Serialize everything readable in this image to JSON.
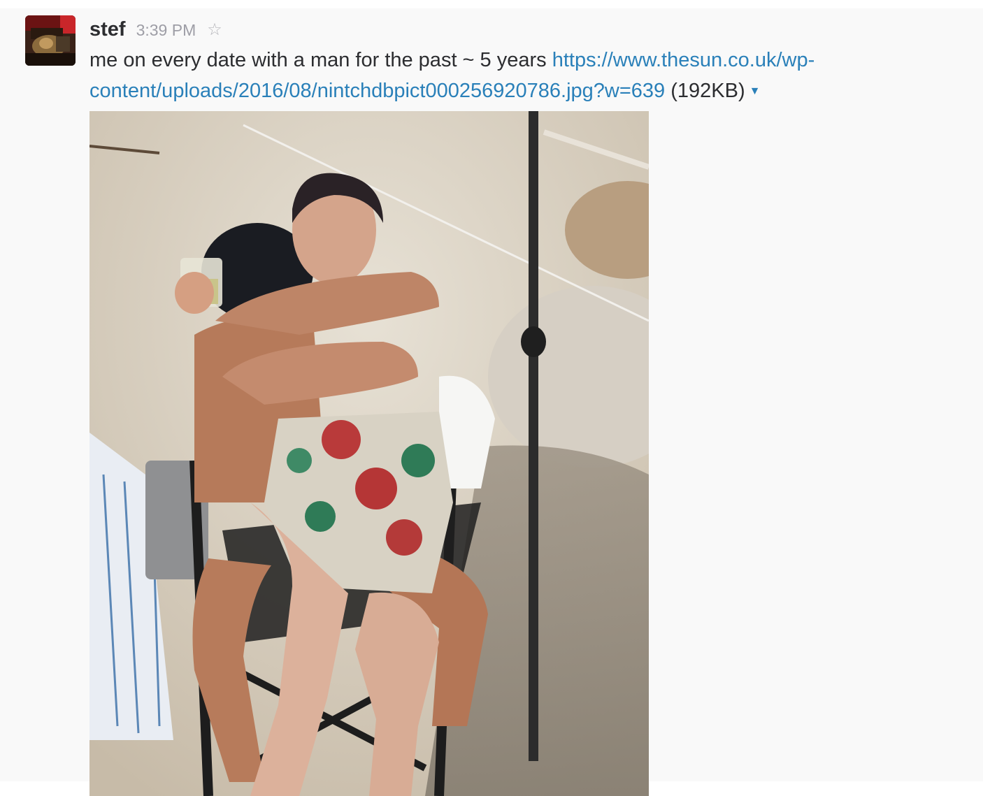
{
  "message": {
    "author": "stef",
    "timestamp": "3:39 PM",
    "text": "me on every date with a man for the past ~ 5 years",
    "link_part1": "https://www.thesun.co.uk/wp-",
    "link_part2": "content/uploads/2016/08/nintchdbpict000256920786.jpg?w=639",
    "file_size": "(192KB)"
  },
  "icons": {
    "star": "star-outline-icon",
    "caret": "caret-down-icon"
  },
  "colors": {
    "link": "#2a80b9",
    "text": "#2c2d30",
    "timestamp": "#9e9ea6",
    "background": "#f9f9f9"
  }
}
